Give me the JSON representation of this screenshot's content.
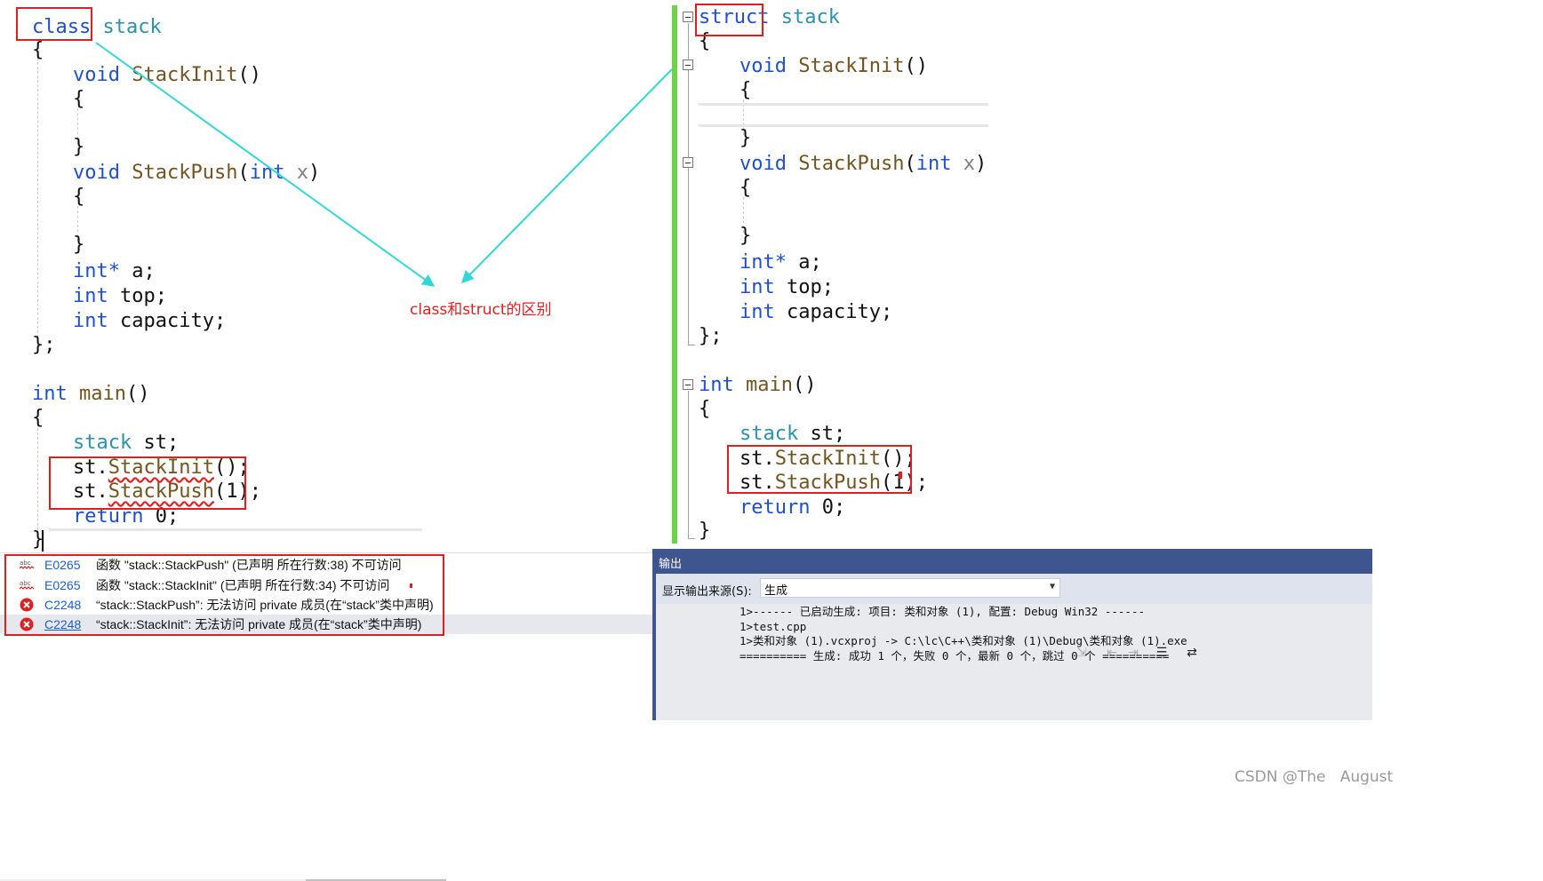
{
  "left_code": {
    "class_kw": "class",
    "class_name": "stack",
    "open_brace": "{",
    "close_brace": "}",
    "class_end": "};",
    "void_kw": "void",
    "init_name": "StackInit",
    "parens": "()",
    "push_name": "StackPush",
    "push_open": "(",
    "int_kw": "int",
    "push_param": "x",
    "push_close": ")",
    "int_ptr": "int*",
    "member_a": " a;",
    "member_top": " top;",
    "member_cap": " capacity;",
    "main_name": "main",
    "stack_decl": " st;",
    "st_dot": "st.",
    "call_init_tail": "();",
    "call_push_tail": "(1);",
    "return_kw": "return",
    "return_val": " 0;"
  },
  "right_code": {
    "struct_kw": "struct",
    "struct_name": "stack"
  },
  "annotation": {
    "label": "class和struct的区别"
  },
  "error_list": [
    {
      "code": "E0265",
      "message": "函数 \"stack::StackPush\" (已声明 所在行数:38) 不可访问"
    },
    {
      "code": "E0265",
      "message": "函数 \"stack::StackInit\" (已声明 所在行数:34) 不可访问"
    },
    {
      "code": "C2248",
      "message": "“stack::StackPush”: 无法访问 private 成员(在“stack”类中声明)"
    },
    {
      "code": "C2248",
      "message": "“stack::StackInit”: 无法访问 private 成员(在“stack”类中声明)"
    }
  ],
  "output_panel": {
    "title": "输出",
    "source_label": "显示输出来源(S):",
    "source_value": "生成",
    "lines": [
      "1>------ 已启动生成: 项目: 类和对象 (1), 配置: Debug Win32 ------",
      "1>test.cpp",
      "1>类和对象 (1).vcxproj -> C:\\lc\\C++\\类和对象 (1)\\Debug\\类和对象 (1).exe",
      "========== 生成: 成功 1 个，失败 0 个，最新 0 个，跳过 0 个 =========="
    ]
  },
  "watermark": "CSDN @The   August",
  "colors": {
    "keyword": "#1f4fd0",
    "type": "#2b91af",
    "function": "#74531f",
    "highlight_box": "#e02020",
    "arrow": "#33d6d6",
    "change_bar": "#6fd24a",
    "panel_header": "#3e5590"
  }
}
